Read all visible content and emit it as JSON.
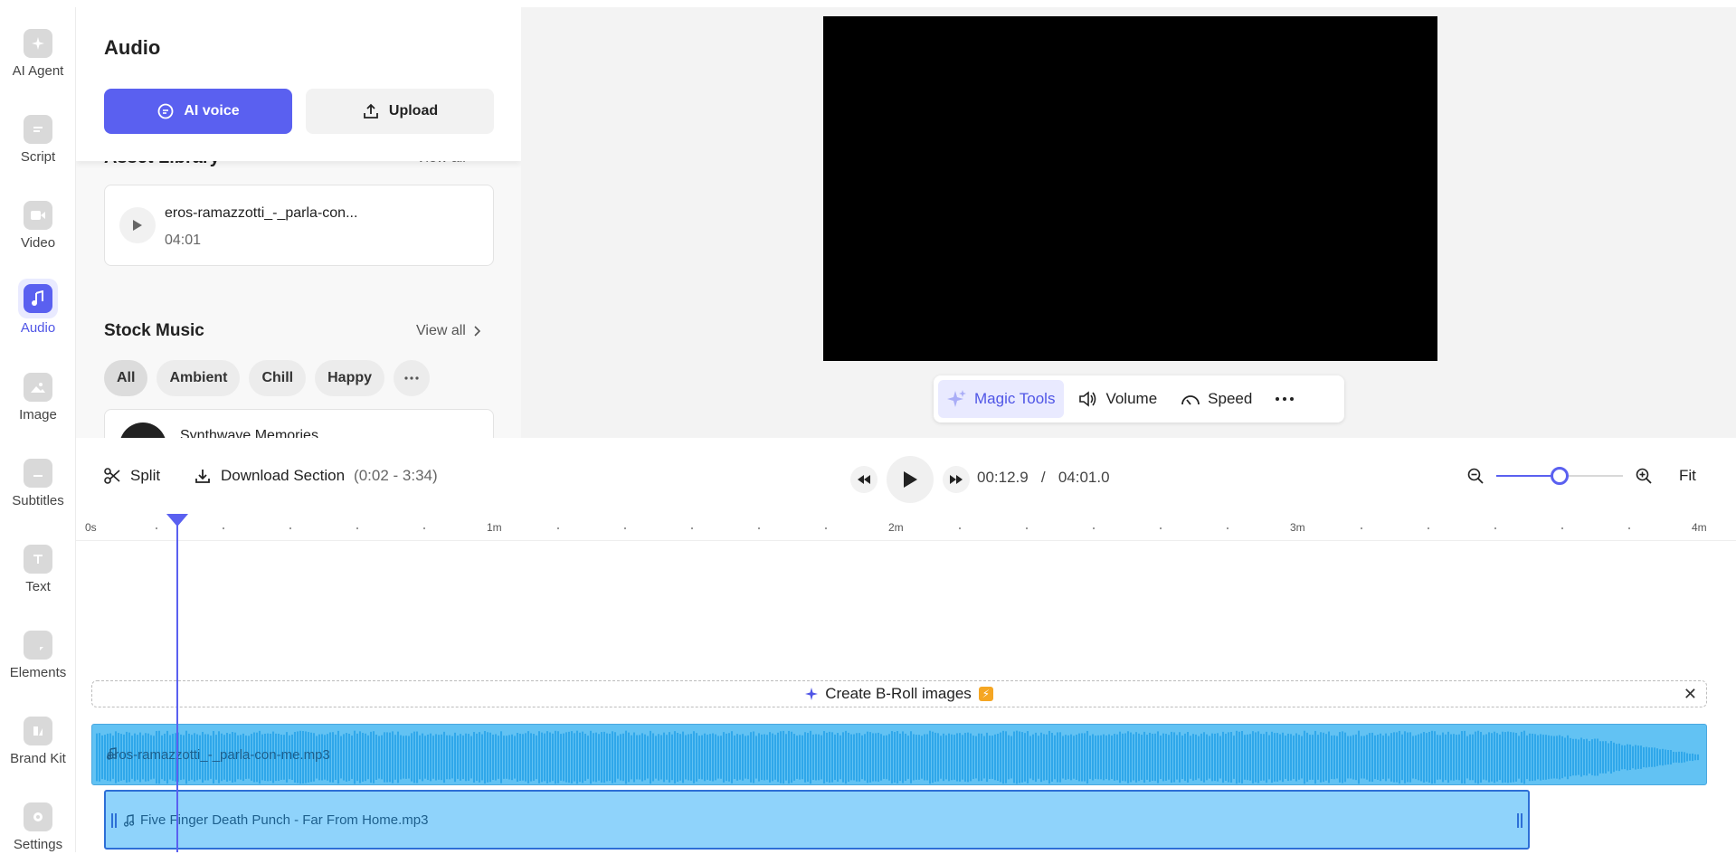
{
  "sidebar": {
    "items": [
      {
        "label": "AI Agent",
        "icon": "sparkle-icon"
      },
      {
        "label": "Script",
        "icon": "script-icon"
      },
      {
        "label": "Video",
        "icon": "video-icon"
      },
      {
        "label": "Audio",
        "icon": "music-note-icon",
        "active": true
      },
      {
        "label": "Image",
        "icon": "image-icon"
      },
      {
        "label": "Subtitles",
        "icon": "subtitles-icon"
      },
      {
        "label": "Text",
        "icon": "text-icon"
      },
      {
        "label": "Elements",
        "icon": "elements-icon"
      },
      {
        "label": "Brand Kit",
        "icon": "brand-kit-icon"
      },
      {
        "label": "Settings",
        "icon": "settings-icon"
      }
    ]
  },
  "panel": {
    "title": "Audio",
    "ai_voice_label": "AI voice",
    "upload_label": "Upload",
    "asset_library": {
      "title": "Asset Library",
      "view_all": "View all",
      "items": [
        {
          "name": "eros-ramazzotti_-_parla-con...",
          "duration": "04:01"
        }
      ]
    },
    "stock_music": {
      "title": "Stock Music",
      "view_all": "View all",
      "chips": [
        "All",
        "Ambient",
        "Chill",
        "Happy"
      ],
      "tracks": [
        {
          "name": "Synthwave Memories"
        }
      ]
    }
  },
  "preview_toolbar": {
    "magic_tools": "Magic Tools",
    "volume": "Volume",
    "speed": "Speed"
  },
  "controls": {
    "split": "Split",
    "download": "Download Section",
    "download_range": "(0:02 - 3:34)",
    "current_time": "00:12.9",
    "separator": "/",
    "total_time": "04:01.0",
    "fit": "Fit",
    "zoom_level_fraction": 0.5
  },
  "ruler": {
    "labels": [
      "0s",
      "1m",
      "2m",
      "3m",
      "4m"
    ]
  },
  "timeline": {
    "broll_label": "Create B-Roll images",
    "broll_badge": "⚡",
    "clip1_label": "eros-ramazzotti_-_parla-con-me.mp3",
    "clip2_label": "Five Finger Death Punch - Far From Home.mp3",
    "playhead_time_s": 12.9
  },
  "colors": {
    "accent": "#5a60f0",
    "clip_blue": "#62c2f3",
    "clip_light": "#8fd3fb"
  }
}
